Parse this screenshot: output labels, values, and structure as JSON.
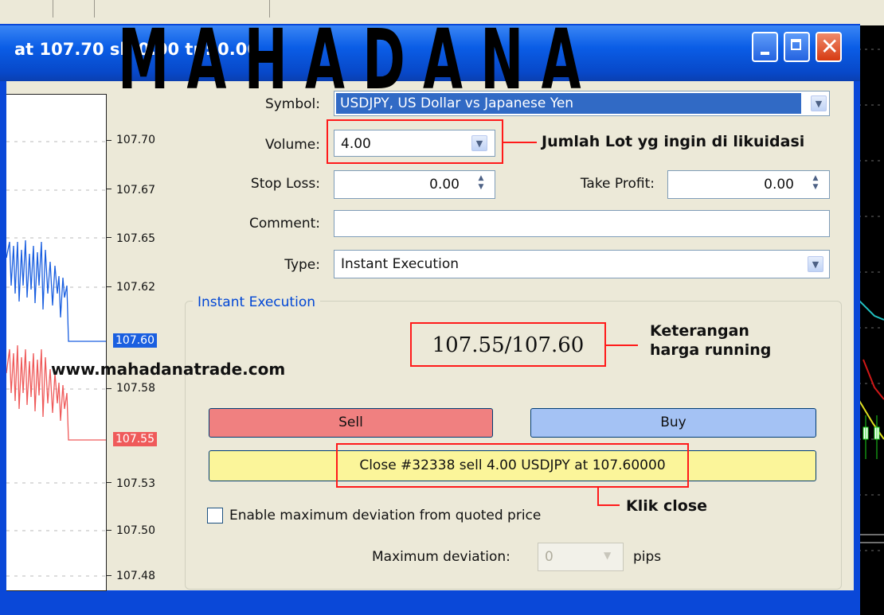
{
  "window": {
    "title": "at 107.70 sl: 0.00 tp: 0.00",
    "controls": [
      "minimize",
      "maximize",
      "close"
    ]
  },
  "price_axis": {
    "labels": [
      "107.70",
      "107.67",
      "107.65",
      "107.62",
      "107.58",
      "107.53",
      "107.50",
      "107.48"
    ],
    "ask_highlight": "107.60",
    "bid_highlight": "107.55",
    "ask_color": "#1a5fe0",
    "bid_color": "#ef5a5a"
  },
  "form": {
    "symbol_label": "Symbol:",
    "symbol_value": "USDJPY, US Dollar vs Japanese Yen",
    "volume_label": "Volume:",
    "volume_value": "4.00",
    "stoploss_label": "Stop Loss:",
    "stoploss_value": "0.00",
    "takeprofit_label": "Take Profit:",
    "takeprofit_value": "0.00",
    "comment_label": "Comment:",
    "comment_value": "",
    "type_label": "Type:",
    "type_value": "Instant Execution"
  },
  "execution": {
    "group_title": "Instant Execution",
    "quote": "107.55/107.60",
    "sell_label": "Sell",
    "buy_label": "Buy",
    "close_label": "Close #32338 sell 4.00 USDJPY at 107.60000",
    "deviation_checkbox_label": "Enable maximum deviation from quoted price",
    "deviation_checked": false,
    "max_deviation_label": "Maximum deviation:",
    "max_deviation_value": "0",
    "max_deviation_unit": "pips",
    "sell_color": "#f08080",
    "buy_color": "#a4c2f4",
    "close_color": "#fbf59a"
  },
  "annotations": {
    "volume_note": "Jumlah Lot yg ingin di likuidasi",
    "price_note": "Keterangan\nharga running",
    "close_note": "Klik close",
    "website": "www.mahadanatrade.com",
    "watermark": "MAHADANA",
    "highlight_color": "#ff1a1a"
  }
}
